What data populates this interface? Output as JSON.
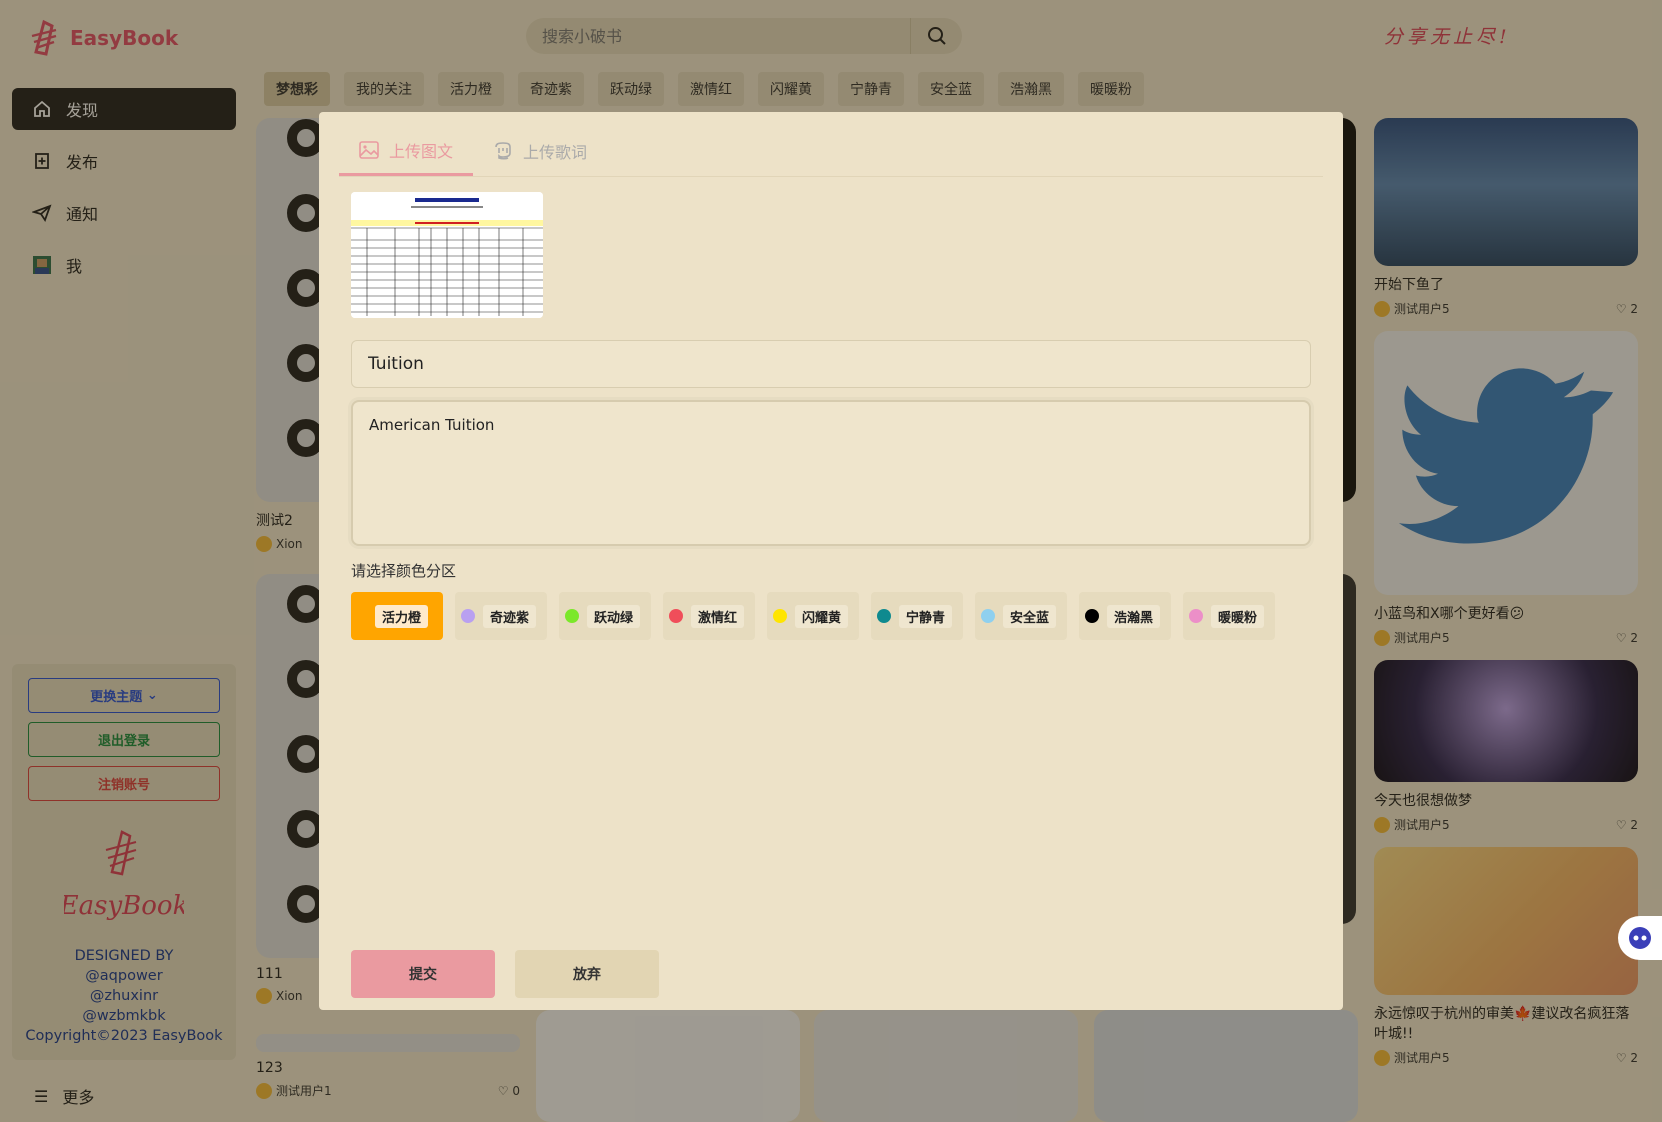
{
  "app": {
    "name": "EasyBook",
    "slogan": "分享无止尽!"
  },
  "search": {
    "placeholder": "搜索小破书"
  },
  "nav": [
    {
      "label": "发现",
      "icon": "home-icon"
    },
    {
      "label": "发布",
      "icon": "publish-icon"
    },
    {
      "label": "通知",
      "icon": "send-icon"
    },
    {
      "label": "我",
      "icon": "avatar-icon"
    }
  ],
  "side": {
    "theme_label": "更换主题",
    "logout_label": "退出登录",
    "cancel_label": "注销账号",
    "logo_text": "EasyBook",
    "credits": [
      "DESIGNED BY",
      "@aqpower",
      "@zhuxinr",
      "@wzbmkbk",
      "Copyright©2023 EasyBook"
    ],
    "more_label": "更多"
  },
  "tags": [
    "梦想彩",
    "我的关注",
    "活力橙",
    "奇迹紫",
    "跃动绿",
    "激情红",
    "闪耀黄",
    "宁静青",
    "安全蓝",
    "浩瀚黑",
    "暖暖粉"
  ],
  "feed_left": [
    {
      "title": "测试2",
      "user": "Xion"
    },
    {
      "title": "111",
      "user": "Xion"
    },
    {
      "title": "123",
      "user": "测试用户1",
      "likes": "0"
    }
  ],
  "feed_right": [
    {
      "title": "开始下鱼了",
      "user": "测试用户5",
      "likes": "2"
    },
    {
      "title": "小蓝鸟和X哪个更好看😕",
      "user": "测试用户5",
      "likes": "2"
    },
    {
      "title": "今天也很想做梦",
      "user": "测试用户5",
      "likes": "2"
    },
    {
      "title": "永远惊叹于杭州的审美🍁建议改名疯狂落叶城!!",
      "user": "测试用户5",
      "likes": "2"
    }
  ],
  "modal": {
    "tab_image": "上传图文",
    "tab_lyrics": "上传歌词",
    "title_value": "Tuition",
    "desc_value": "American Tuition",
    "color_label": "请选择颜色分区",
    "colors": [
      {
        "name": "活力橙",
        "color": "#ffa500",
        "selected": true
      },
      {
        "name": "奇迹紫",
        "color": "#b9a0f0"
      },
      {
        "name": "跃动绿",
        "color": "#7be82a"
      },
      {
        "name": "激情红",
        "color": "#f04e5a"
      },
      {
        "name": "闪耀黄",
        "color": "#ffe500"
      },
      {
        "name": "宁静青",
        "color": "#0f8a8f"
      },
      {
        "name": "安全蓝",
        "color": "#8fd0ef"
      },
      {
        "name": "浩瀚黑",
        "color": "#000000"
      },
      {
        "name": "暖暖粉",
        "color": "#ec8fc8"
      }
    ],
    "submit_label": "提交",
    "discard_label": "放弃"
  }
}
